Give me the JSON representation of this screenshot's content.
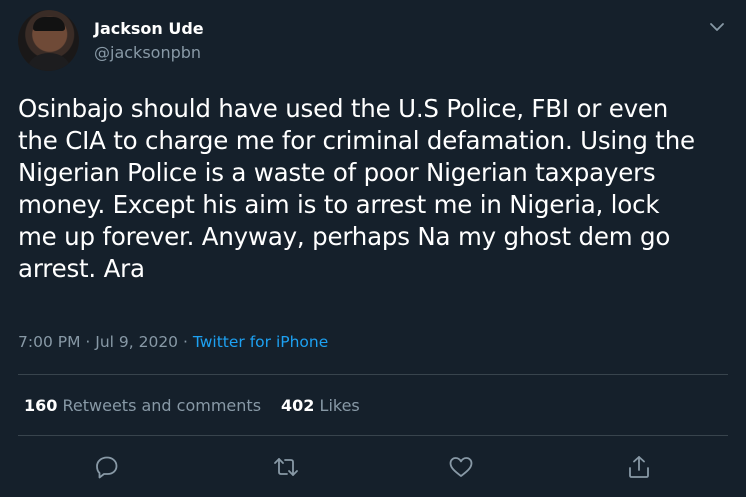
{
  "author": {
    "name": "Jackson Ude",
    "handle": "@jacksonpbn"
  },
  "tweet": {
    "lines": [
      "Osinbajo should have used the U.S Police, FBI or even",
      "the CIA to charge me for criminal defamation. Using the",
      "Nigerian Police is a waste of poor Nigerian taxpayers",
      "money. Except his aim is to arrest me in Nigeria, lock",
      "me up forever. Anyway, perhaps Na my ghost dem go",
      "arrest. Ara"
    ]
  },
  "meta": {
    "time": "7:00 PM",
    "sep1": " · ",
    "date": "Jul 9, 2020",
    "sep2": " · ",
    "source": "Twitter for iPhone"
  },
  "stats": {
    "retweets_count": "160",
    "retweets_label": "Retweets and comments",
    "likes_count": "402",
    "likes_label": "Likes"
  },
  "icons": {
    "menu": "chevron-down-icon",
    "reply": "reply-icon",
    "retweet": "retweet-icon",
    "like": "heart-icon",
    "share": "share-icon"
  },
  "colors": {
    "background": "#15202b",
    "text": "#ffffff",
    "secondary": "#8899a6",
    "link": "#1da1f2",
    "divider": "#38444d"
  }
}
